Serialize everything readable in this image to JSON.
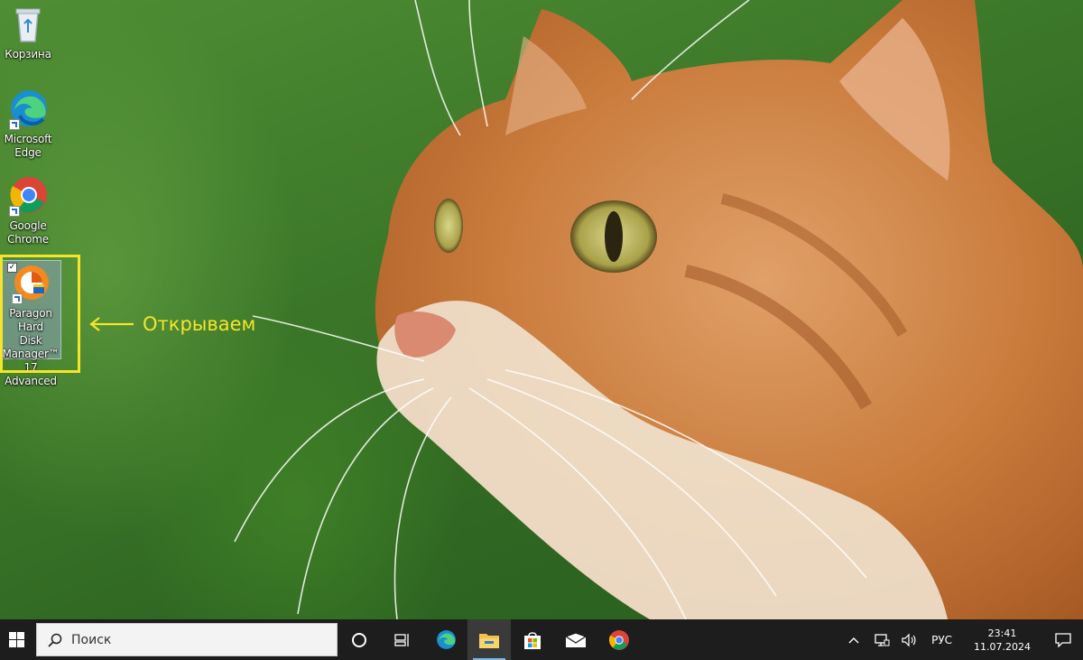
{
  "desktop": {
    "icons": [
      {
        "label": "Корзина",
        "icon": "recycle-bin-icon"
      },
      {
        "label": "Microsoft Edge",
        "icon": "edge-icon"
      },
      {
        "label": "Google Chrome",
        "icon": "chrome-icon"
      },
      {
        "label_lines": [
          "Paragon Hard",
          "Disk",
          "Manager™ 17",
          "Advanced"
        ],
        "icon": "paragon-hdm-icon",
        "selected": true
      }
    ],
    "annotation": {
      "text": "Открываем",
      "color": "#f5e52a"
    }
  },
  "taskbar": {
    "search_placeholder": "Поиск",
    "pinned": [
      "task-view-icon",
      "edge-icon",
      "file-explorer-icon",
      "store-icon",
      "mail-icon",
      "chrome-icon"
    ],
    "tray": {
      "language": "РУС",
      "time": "23:41",
      "date": "11.07.2024"
    }
  },
  "colors": {
    "taskbar": "#1d1d1d",
    "highlight": "#f5e52a",
    "accent": "#76b9ed"
  }
}
